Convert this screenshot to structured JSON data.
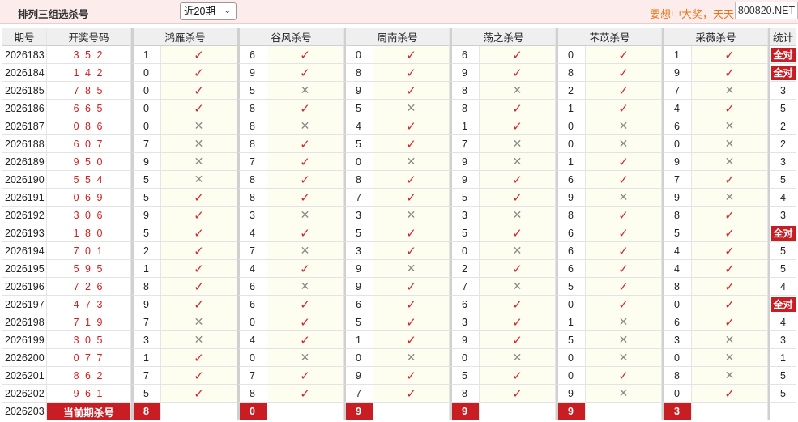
{
  "header": {
    "title": "排列三组选杀号",
    "period_select": "近20期",
    "slogan": "要想中大奖，天天",
    "watermark": "800820.NET"
  },
  "columns": {
    "issue": "期号",
    "draw": "开奖号码",
    "experts": [
      "鸿雁杀号",
      "谷风杀号",
      "周南杀号",
      "荡之杀号",
      "芣苡杀号",
      "采薇杀号"
    ],
    "stat": "统计"
  },
  "symbols": {
    "hit": "✓",
    "miss": "✕"
  },
  "rows": [
    {
      "issue": "2026183",
      "draw": "3 5 2",
      "kills": [
        "1",
        "6",
        "0",
        "6",
        "0",
        "1"
      ],
      "hits": [
        true,
        true,
        true,
        true,
        true,
        true
      ],
      "stat": "全对"
    },
    {
      "issue": "2026184",
      "draw": "1 4 2",
      "kills": [
        "0",
        "9",
        "8",
        "9",
        "8",
        "9"
      ],
      "hits": [
        true,
        true,
        true,
        true,
        true,
        true
      ],
      "stat": "全对"
    },
    {
      "issue": "2026185",
      "draw": "7 8 5",
      "kills": [
        "0",
        "5",
        "9",
        "8",
        "2",
        "7"
      ],
      "hits": [
        true,
        false,
        true,
        false,
        true,
        false
      ],
      "stat": "3"
    },
    {
      "issue": "2026186",
      "draw": "6 6 5",
      "kills": [
        "0",
        "8",
        "5",
        "8",
        "1",
        "4"
      ],
      "hits": [
        true,
        true,
        false,
        true,
        true,
        true
      ],
      "stat": "5"
    },
    {
      "issue": "2026187",
      "draw": "0 8 6",
      "kills": [
        "0",
        "8",
        "4",
        "1",
        "0",
        "6"
      ],
      "hits": [
        false,
        false,
        true,
        true,
        false,
        false
      ],
      "stat": "2"
    },
    {
      "issue": "2026188",
      "draw": "6 0 7",
      "kills": [
        "7",
        "8",
        "5",
        "7",
        "0",
        "0"
      ],
      "hits": [
        false,
        true,
        true,
        false,
        false,
        false
      ],
      "stat": "2"
    },
    {
      "issue": "2026189",
      "draw": "9 5 0",
      "kills": [
        "9",
        "7",
        "0",
        "9",
        "1",
        "9"
      ],
      "hits": [
        false,
        true,
        false,
        false,
        true,
        false
      ],
      "stat": "3"
    },
    {
      "issue": "2026190",
      "draw": "5 5 4",
      "kills": [
        "5",
        "8",
        "8",
        "9",
        "6",
        "7"
      ],
      "hits": [
        false,
        true,
        true,
        true,
        true,
        true
      ],
      "stat": "5"
    },
    {
      "issue": "2026191",
      "draw": "0 6 9",
      "kills": [
        "5",
        "8",
        "7",
        "5",
        "9",
        "9"
      ],
      "hits": [
        true,
        true,
        true,
        true,
        false,
        false
      ],
      "stat": "4"
    },
    {
      "issue": "2026192",
      "draw": "3 0 6",
      "kills": [
        "9",
        "3",
        "3",
        "3",
        "8",
        "8"
      ],
      "hits": [
        true,
        false,
        false,
        false,
        true,
        true
      ],
      "stat": "3"
    },
    {
      "issue": "2026193",
      "draw": "1 8 0",
      "kills": [
        "5",
        "4",
        "5",
        "5",
        "6",
        "5"
      ],
      "hits": [
        true,
        true,
        true,
        true,
        true,
        true
      ],
      "stat": "全对"
    },
    {
      "issue": "2026194",
      "draw": "7 0 1",
      "kills": [
        "2",
        "7",
        "3",
        "0",
        "6",
        "4"
      ],
      "hits": [
        true,
        false,
        true,
        false,
        true,
        true
      ],
      "stat": "5"
    },
    {
      "issue": "2026195",
      "draw": "5 9 5",
      "kills": [
        "1",
        "4",
        "9",
        "2",
        "6",
        "4"
      ],
      "hits": [
        true,
        true,
        false,
        true,
        true,
        true
      ],
      "stat": "5"
    },
    {
      "issue": "2026196",
      "draw": "7 2 6",
      "kills": [
        "8",
        "6",
        "9",
        "7",
        "5",
        "8"
      ],
      "hits": [
        true,
        false,
        true,
        false,
        true,
        true
      ],
      "stat": "4"
    },
    {
      "issue": "2026197",
      "draw": "4 7 3",
      "kills": [
        "9",
        "6",
        "6",
        "6",
        "0",
        "0"
      ],
      "hits": [
        true,
        true,
        true,
        true,
        true,
        true
      ],
      "stat": "全对"
    },
    {
      "issue": "2026198",
      "draw": "7 1 9",
      "kills": [
        "7",
        "0",
        "5",
        "3",
        "1",
        "6"
      ],
      "hits": [
        false,
        true,
        true,
        true,
        false,
        true
      ],
      "stat": "4"
    },
    {
      "issue": "2026199",
      "draw": "3 0 5",
      "kills": [
        "3",
        "4",
        "1",
        "9",
        "5",
        "3"
      ],
      "hits": [
        false,
        true,
        true,
        true,
        false,
        false
      ],
      "stat": "3"
    },
    {
      "issue": "2026200",
      "draw": "0 7 7",
      "kills": [
        "1",
        "0",
        "0",
        "0",
        "0",
        "0"
      ],
      "hits": [
        true,
        false,
        false,
        false,
        false,
        false
      ],
      "stat": "1"
    },
    {
      "issue": "2026201",
      "draw": "8 6 2",
      "kills": [
        "7",
        "7",
        "9",
        "5",
        "0",
        "8"
      ],
      "hits": [
        true,
        true,
        true,
        true,
        true,
        false
      ],
      "stat": "5"
    },
    {
      "issue": "2026202",
      "draw": "9 6 1",
      "kills": [
        "5",
        "8",
        "7",
        "8",
        "9",
        "0"
      ],
      "hits": [
        true,
        true,
        true,
        true,
        false,
        true
      ],
      "stat": "5"
    }
  ],
  "current": {
    "issue": "2026203",
    "label": "当前期杀号",
    "kills": [
      "8",
      "0",
      "9",
      "9",
      "9",
      "3"
    ]
  },
  "colors": {
    "hit": "#d9262c",
    "miss": "#8a8a8a",
    "badge": "#c81e23",
    "header_bg": "#efefef"
  }
}
